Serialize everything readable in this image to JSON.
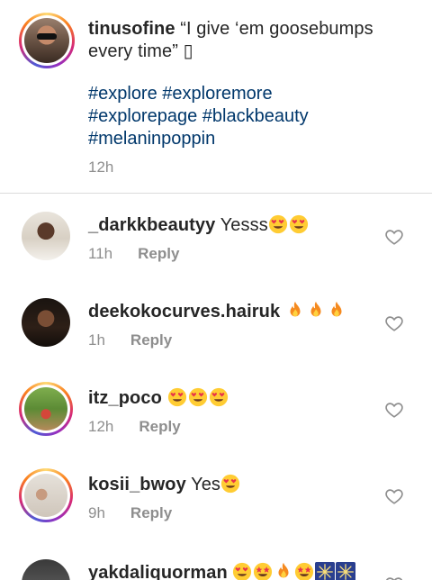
{
  "post_caption": {
    "username": "tinusofine",
    "text_line1": "“I give ‘em goosebumps",
    "text_line2": "every time” ▯",
    "hashtags": [
      "#explore #exploremore",
      "#explorepage #blackbeauty",
      "#melaninpoppin"
    ],
    "time": "12h"
  },
  "comments": [
    {
      "username": "_darkkbeautyy",
      "text": "Yesss",
      "emojis": [
        "heart-eyes",
        "heart-eyes"
      ],
      "time": "11h",
      "reply_label": "Reply"
    },
    {
      "username": "deekokocurves.hairuk",
      "text": "",
      "emojis": [
        "fire",
        "fire",
        "fire"
      ],
      "time": "1h",
      "reply_label": "Reply"
    },
    {
      "username": "itz_poco",
      "text": "",
      "emojis": [
        "heart-eyes",
        "heart-eyes",
        "heart-eyes"
      ],
      "time": "12h",
      "reply_label": "Reply"
    },
    {
      "username": "kosii_bwoy",
      "text": "Yes",
      "emojis": [
        "heart-eyes"
      ],
      "time": "9h",
      "reply_label": "Reply"
    },
    {
      "username": "yakdaliquorman",
      "text": "",
      "emojis": [
        "heart-eyes",
        "star-struck",
        "fire",
        "star-struck",
        "fireworks",
        "fireworks"
      ]
    }
  ],
  "colors": {
    "username": "#262626",
    "hashtag": "#00376b",
    "meta": "#8e8e8e",
    "divider": "#dbdbdb"
  },
  "icons": {
    "like": "heart-outline-icon"
  }
}
